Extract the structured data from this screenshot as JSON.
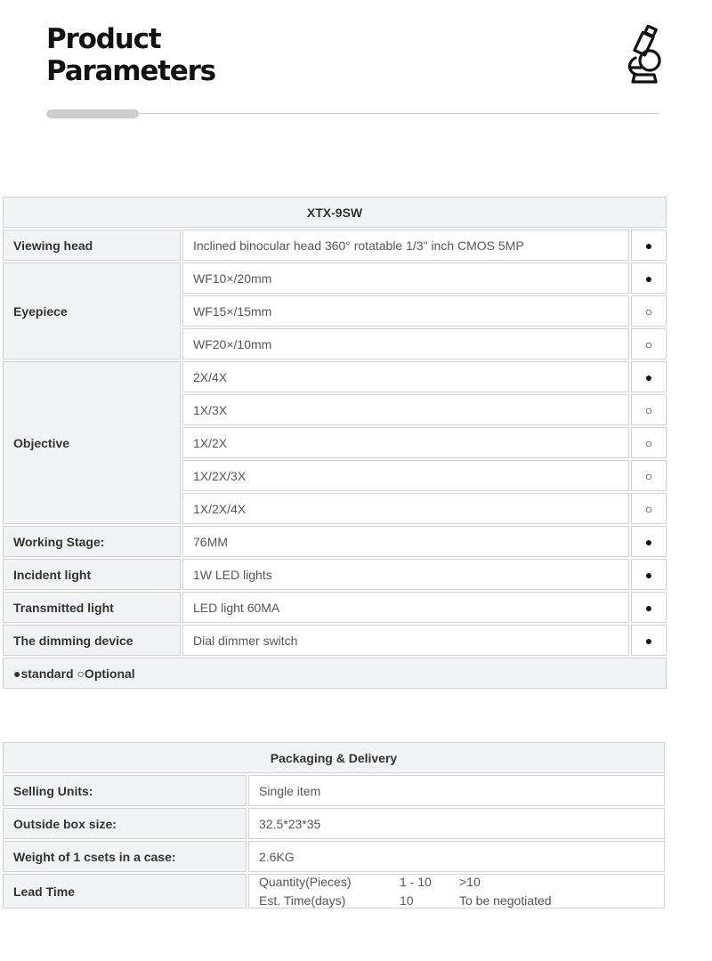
{
  "header": {
    "title_line1": "Product",
    "title_line2": "Parameters",
    "icon": "microscope-icon"
  },
  "spec_table": {
    "model": "XTX-9SW",
    "rows": [
      {
        "label": "Viewing head",
        "value": "Inclined binocular head 360° rotatable 1/3\" inch CMOS 5MP",
        "mark": "●"
      },
      {
        "label": "Eyepiece",
        "value": "WF10×/20mm",
        "mark": "●"
      },
      {
        "label": "",
        "value": "WF15×/15mm",
        "mark": "○"
      },
      {
        "label": "",
        "value": "WF20×/10mm",
        "mark": "○"
      },
      {
        "label": "Objective",
        "value": "2X/4X",
        "mark": "●"
      },
      {
        "label": "",
        "value": "1X/3X",
        "mark": "○"
      },
      {
        "label": "",
        "value": "1X/2X",
        "mark": "○"
      },
      {
        "label": "",
        "value": "1X/2X/3X",
        "mark": "○"
      },
      {
        "label": "",
        "value": "1X/2X/4X",
        "mark": "○"
      },
      {
        "label": "Working Stage:",
        "value": "76MM",
        "mark": "●"
      },
      {
        "label": "Incident light",
        "value": "1W LED lights",
        "mark": "●"
      },
      {
        "label": "Transmitted light",
        "value": "LED light 60MA",
        "mark": "●"
      },
      {
        "label": "The dimming device",
        "value": "Dial dimmer switch",
        "mark": "●"
      }
    ],
    "legend": "●standard ○Optional"
  },
  "packaging": {
    "title": "Packaging & Delivery",
    "rows": [
      {
        "label": "Selling Units:",
        "value": "Single item"
      },
      {
        "label": "Outside box size:",
        "value": "32.5*23*35"
      },
      {
        "label": "Weight of 1 csets in a case:",
        "value": "2.6KG"
      }
    ],
    "lead_time": {
      "label": "Lead Time",
      "row1": {
        "col1": "Quantity(Pieces)",
        "col2": "1 - 10",
        "col3": ">10"
      },
      "row2": {
        "col1": "Est. Time(days)",
        "col2": "10",
        "col3": "To be negotiated"
      }
    }
  }
}
